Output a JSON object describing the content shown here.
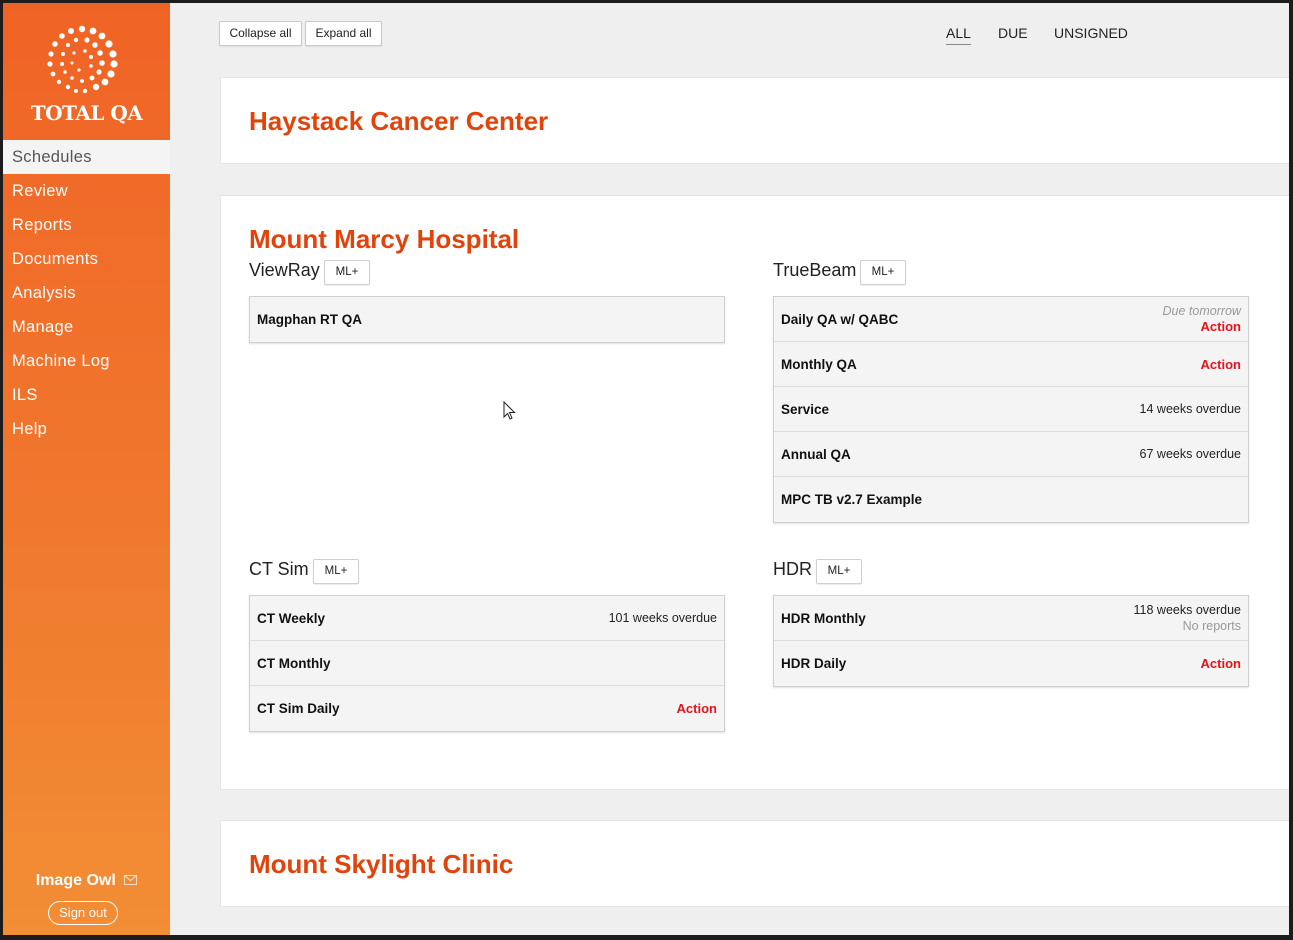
{
  "app": {
    "logo_text": "TOTAL QA"
  },
  "sidebar": {
    "items": [
      {
        "label": "Schedules"
      },
      {
        "label": "Review"
      },
      {
        "label": "Reports"
      },
      {
        "label": "Documents"
      },
      {
        "label": "Analysis"
      },
      {
        "label": "Manage"
      },
      {
        "label": "Machine Log"
      },
      {
        "label": "ILS"
      },
      {
        "label": "Help"
      }
    ],
    "user_name": "Image Owl",
    "signout_label": "Sign out"
  },
  "toolbar": {
    "collapse_label": "Collapse all",
    "expand_label": "Expand all",
    "filters": [
      {
        "label": "ALL"
      },
      {
        "label": "DUE"
      },
      {
        "label": "UNSIGNED"
      }
    ]
  },
  "sites": [
    {
      "title": "Haystack Cancer Center"
    },
    {
      "title": "Mount Marcy Hospital",
      "machines": [
        {
          "name": "ViewRay",
          "ml_label": "ML+",
          "tasks": [
            {
              "name": "Magphan RT QA"
            }
          ]
        },
        {
          "name": "TrueBeam",
          "ml_label": "ML+",
          "tasks": [
            {
              "name": "Daily QA w/ QABC",
              "status_line1": "Due tomorrow",
              "status_line2": "Action"
            },
            {
              "name": "Monthly QA",
              "status": "Action"
            },
            {
              "name": "Service",
              "status": "14 weeks overdue"
            },
            {
              "name": "Annual QA",
              "status": "67 weeks overdue"
            },
            {
              "name": "MPC TB v2.7 Example"
            }
          ]
        },
        {
          "name": "CT Sim",
          "ml_label": "ML+",
          "tasks": [
            {
              "name": "CT Weekly",
              "status": "101 weeks overdue"
            },
            {
              "name": "CT Monthly"
            },
            {
              "name": "CT Sim Daily",
              "status": "Action"
            }
          ]
        },
        {
          "name": "HDR",
          "ml_label": "ML+",
          "tasks": [
            {
              "name": "HDR Monthly",
              "status_line1": "118 weeks overdue",
              "status_line2": "No reports"
            },
            {
              "name": "HDR Daily",
              "status": "Action"
            }
          ]
        }
      ]
    },
    {
      "title": "Mount Skylight Clinic"
    }
  ],
  "colors": {
    "brand_orange": "#f06326",
    "title_red": "#e2430b",
    "action_red": "#e3141b"
  }
}
